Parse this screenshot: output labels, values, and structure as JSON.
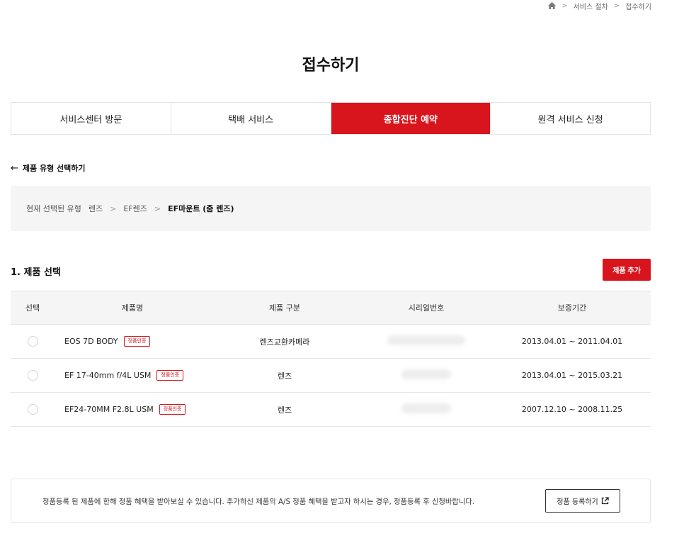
{
  "breadcrumb": {
    "home_icon": "home-icon",
    "items": [
      "서비스 절차",
      "접수하기"
    ],
    "separator": ">"
  },
  "page_title": "접수하기",
  "tabs": [
    {
      "label": "서비스센터 방문",
      "active": false
    },
    {
      "label": "택배 서비스",
      "active": false
    },
    {
      "label": "종합진단 예약",
      "active": true
    },
    {
      "label": "원격 서비스 신청",
      "active": false
    }
  ],
  "back_link": {
    "arrow": "←",
    "label": "제품 유형 선택하기"
  },
  "selected_path": {
    "label": "현재 선택된 유형",
    "items": [
      "렌즈",
      "EF렌즈"
    ],
    "current": "EF마운트 (줌 렌즈)",
    "separator": ">"
  },
  "product_section": {
    "title": "1. 제품 선택",
    "add_button_label": "제품 추가"
  },
  "table": {
    "headers": [
      "선택",
      "제품명",
      "제품 구분",
      "시리얼번호",
      "보증기간"
    ],
    "rows": [
      {
        "name": "EOS 7D BODY",
        "badge": "정품인증",
        "type": "렌즈교환카메라",
        "warranty": "2013.04.01 ~ 2011.04.01",
        "selected": false
      },
      {
        "name": "EF 17-40mm f/4L USM",
        "badge": "정품인증",
        "type": "렌즈",
        "warranty": "2013.04.01 ~ 2015.03.21",
        "selected": false
      },
      {
        "name": "EF24-70MM F2.8L USM",
        "badge": "정품인증",
        "type": "렌즈",
        "warranty": "2007.12.10 ~ 2008.11.25",
        "selected": false
      }
    ]
  },
  "notice": {
    "text": "정품등록 된 제품에 한해 정품 혜택을 받아보실 수 있습니다. 추가하신 제품의 A/S 정품 혜택을 받고자 하시는 경우, 정품등록 후 신청바랍니다.",
    "button_label": "정품 등록하기",
    "button_icon": "external-link-icon"
  },
  "colors": {
    "accent": "#d8141c",
    "panel_bg": "#f5f5f6",
    "border": "#e3e3e3"
  }
}
